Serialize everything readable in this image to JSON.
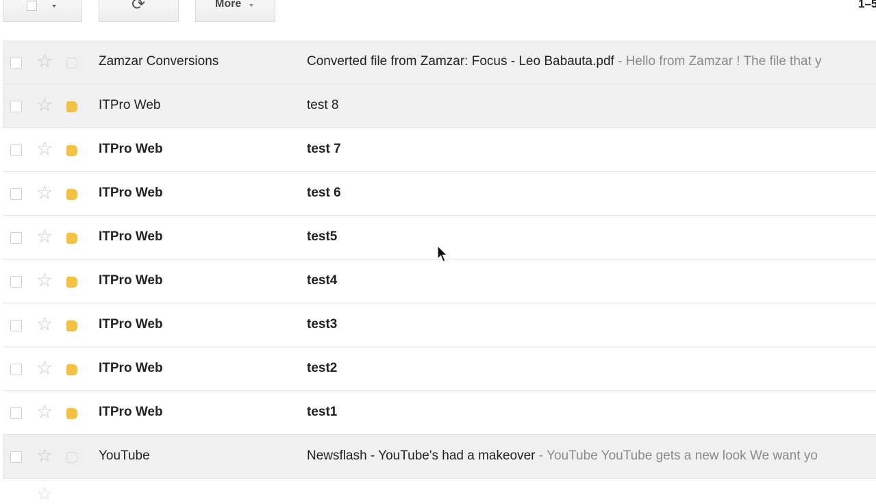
{
  "toolbar": {
    "refresh_icon": "⟳",
    "more_label": "More",
    "pager_text": "1–5"
  },
  "icons": {
    "star": "star-icon",
    "label": "label-tag-icon",
    "refresh": "refresh-icon",
    "checkbox": "checkbox-icon",
    "cursor": "mouse-pointer-icon"
  },
  "colors": {
    "label_yellow": "#f4c240",
    "read_row_bg": "#f0f0f0",
    "snippet_gray": "#8a8a8a"
  },
  "emails": [
    {
      "sender": "Zamzar Conversions",
      "subject": "Converted file from Zamzar: Focus - Leo Babauta.pdf",
      "snippet": " - Hello from Zamzar ! The file that y",
      "unread": false,
      "label": "none"
    },
    {
      "sender": "ITPro Web",
      "subject": "test 8",
      "snippet": "",
      "unread": false,
      "label": "yellow"
    },
    {
      "sender": "ITPro Web",
      "subject": "test 7",
      "snippet": "",
      "unread": true,
      "label": "yellow"
    },
    {
      "sender": "ITPro Web",
      "subject": "test 6",
      "snippet": "",
      "unread": true,
      "label": "yellow"
    },
    {
      "sender": "ITPro Web",
      "subject": "test5",
      "snippet": "",
      "unread": true,
      "label": "yellow"
    },
    {
      "sender": "ITPro Web",
      "subject": "test4",
      "snippet": "",
      "unread": true,
      "label": "yellow"
    },
    {
      "sender": "ITPro Web",
      "subject": "test3",
      "snippet": "",
      "unread": true,
      "label": "yellow"
    },
    {
      "sender": "ITPro Web",
      "subject": "test2",
      "snippet": "",
      "unread": true,
      "label": "yellow"
    },
    {
      "sender": "ITPro Web",
      "subject": "test1",
      "snippet": "",
      "unread": true,
      "label": "yellow"
    },
    {
      "sender": "YouTube",
      "subject": "Newsflash - YouTube's had a makeover",
      "snippet": " - YouTube YouTube gets a new look We want yo",
      "unread": false,
      "label": "none"
    }
  ]
}
